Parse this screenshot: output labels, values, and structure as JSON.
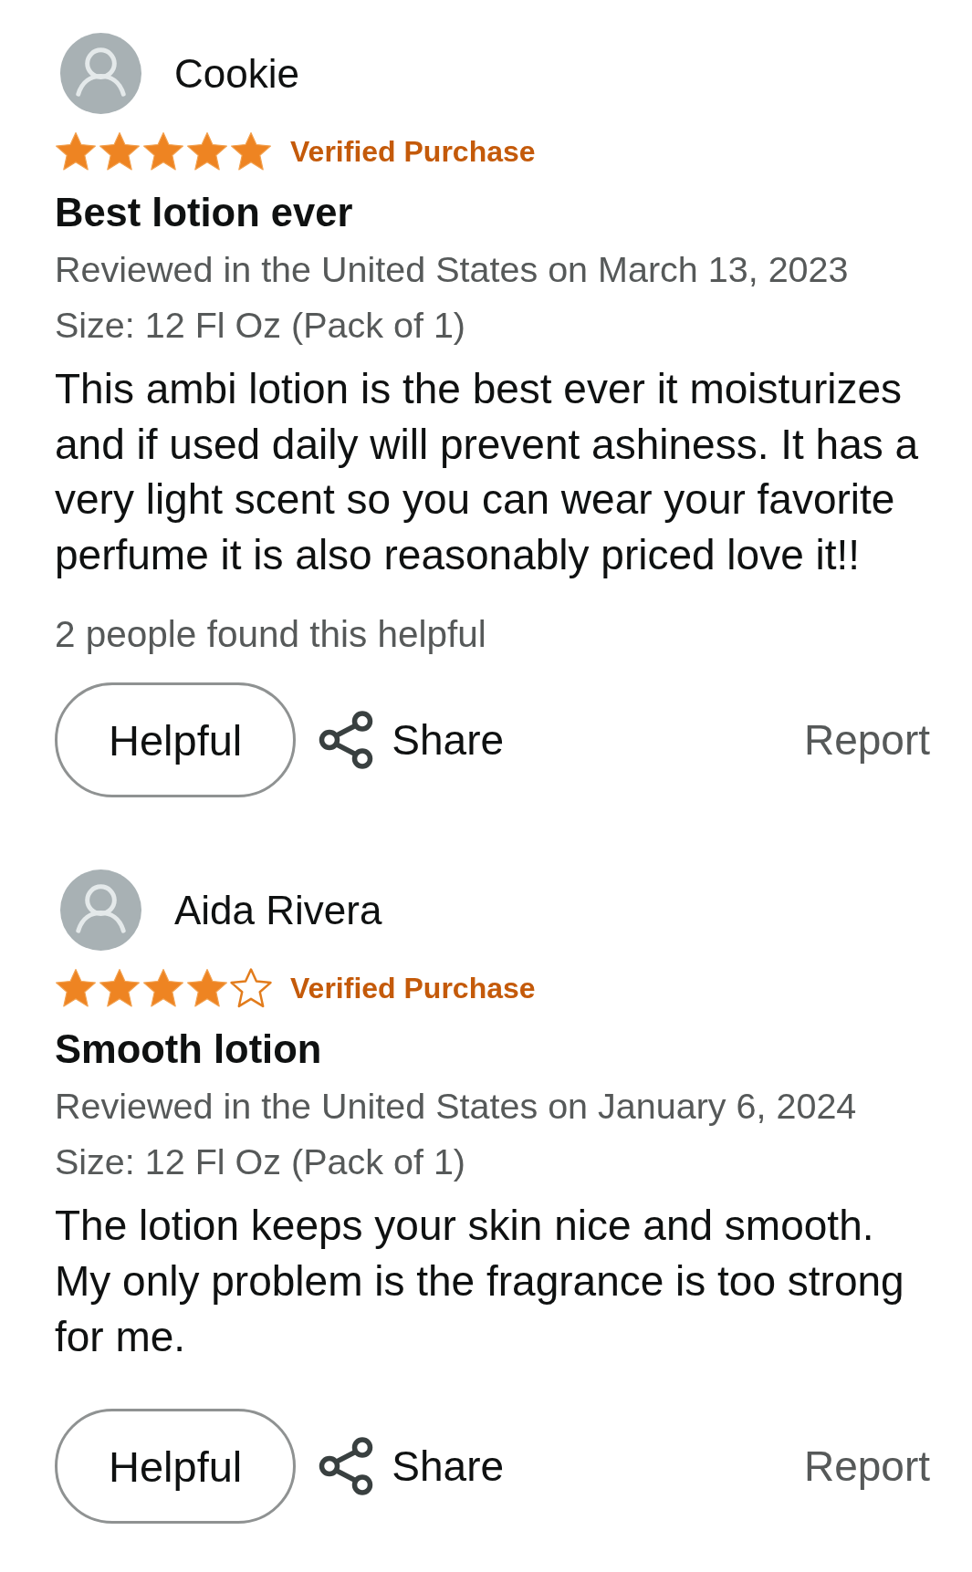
{
  "reviews": [
    {
      "author": "Cookie",
      "stars": 5,
      "badge": "Verified Purchase",
      "title": "Best lotion ever",
      "date_line": "Reviewed in the United States on March 13, 2023",
      "size_line": "Size: 12 Fl Oz (Pack of 1)",
      "body": "This ambi lotion is the best ever it moisturizes and if used daily will prevent ashiness. It has a very light scent so you can wear your favorite perfume it is also reasonably priced love it!!",
      "helpful_count": "2 people found this helpful",
      "actions": {
        "helpful": "Helpful",
        "share": "Share",
        "report": "Report"
      }
    },
    {
      "author": "Aida Rivera",
      "stars": 4,
      "badge": "Verified Purchase",
      "title": "Smooth lotion",
      "date_line": "Reviewed in the United States on January 6, 2024",
      "size_line": "Size: 12 Fl Oz (Pack of 1)",
      "body": "The lotion keeps your skin nice and smooth. My only problem is the fragrance is too strong for me.",
      "actions": {
        "helpful": "Helpful",
        "share": "Share",
        "report": "Report"
      }
    }
  ]
}
